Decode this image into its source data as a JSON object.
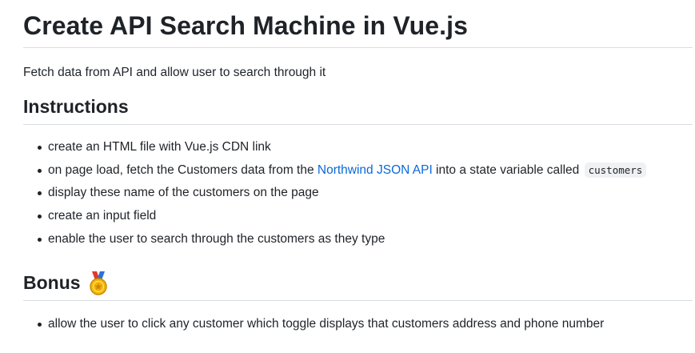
{
  "title": "Create API Search Machine in Vue.js",
  "lead": "Fetch data from API and allow user to search through it",
  "instructions": {
    "heading": "Instructions",
    "items": [
      {
        "text": "create an HTML file with Vue.js CDN link"
      },
      {
        "before": "on page load, fetch the Customers data from the ",
        "link": "Northwind JSON API",
        "middle": " into a state variable called ",
        "code": "customers"
      },
      {
        "text": "display these name of the customers on the page"
      },
      {
        "text": "create an input field"
      },
      {
        "text": "enable the user to search through the customers as they type"
      }
    ]
  },
  "bonus": {
    "heading": "Bonus",
    "icon": "medal-icon",
    "items": [
      {
        "text": "allow the user to click any customer which toggle displays that customers address and phone number"
      }
    ]
  },
  "colors": {
    "text": "#1f2328",
    "link": "#0969da",
    "divider": "#d8dee4",
    "code_bg": "#eff1f3",
    "medal_gold": "#f5b301",
    "ribbon_red": "#e03a2f"
  }
}
